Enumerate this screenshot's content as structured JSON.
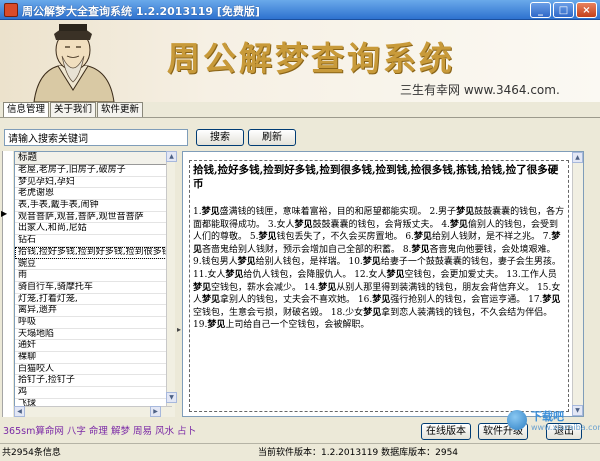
{
  "window": {
    "title": "周公解梦大全查询系统 1.2.2013119 [免费版]",
    "controls": [
      "_",
      "□",
      "×"
    ]
  },
  "banner": {
    "title": "周公解梦查询系统",
    "subtitle": "三生有幸网 www.3464.com."
  },
  "tabs": [
    "信息管理",
    "关于我们",
    "软件更新"
  ],
  "search": {
    "placeholder": "请输入搜索关键词",
    "search_label": "搜索",
    "refresh_label": "刷新"
  },
  "list": {
    "header": "标题",
    "items": [
      "老屋,老房子,旧房子,破房子",
      "梦见孕妇,孕妇",
      "老虎谢恩",
      "表,手表,戴手表,闹钟",
      "观音菩萨,观音,菩萨,观世音菩萨",
      "出家人,和尚,尼姑",
      "钻石",
      "拾钱,捡好多钱,捡到好多钱,捡到很多钱",
      "豌豆",
      "雨",
      "骑自行车,骑摩托车",
      "灯笼,打着灯笼,",
      "离异,遗弃",
      "呼吸",
      "天塌地陷",
      "通奸",
      "裸聊",
      "白猫咬人",
      "拾钉子,捡钉子",
      "鸡",
      "飞球"
    ],
    "selected_index": 7
  },
  "detail": {
    "title": "拾钱,捡好多钱,捡到好多钱,捡到很多钱,捡到钱,捡很多钱,拣钱,拾钱,捡了很多硬币",
    "body": [
      {
        "t": "1."
      },
      {
        "b": "梦见"
      },
      {
        "t": "盛满钱的钱匣，意味着富裕，目的和愿望都能实现。  2.男子"
      },
      {
        "b": "梦见"
      },
      {
        "t": "鼓鼓囊囊的钱包，各方面都能取得成功。  3.女人"
      },
      {
        "b": "梦见"
      },
      {
        "t": "鼓鼓囊囊的钱包，会背叛丈夫。  4."
      },
      {
        "b": "梦见"
      },
      {
        "t": "偷别人的钱包，会受到人们的尊敬。  5."
      },
      {
        "b": "梦见"
      },
      {
        "t": "钱包丢失了，不久会买房置地。  6."
      },
      {
        "b": "梦见"
      },
      {
        "t": "给别人钱财，是不祥之兆。  7."
      },
      {
        "b": "梦见"
      },
      {
        "t": "吝啬鬼给别人钱财，预示会增加自己全部的积蓄。  8."
      },
      {
        "b": "梦见"
      },
      {
        "t": "吝啬鬼向他要钱，会处境艰难。  9.钱包男人"
      },
      {
        "b": "梦见"
      },
      {
        "t": "给别人钱包，是祥瑞。  10."
      },
      {
        "b": "梦见"
      },
      {
        "t": "给妻子一个鼓鼓囊囊的钱包，妻子会生男孩。  11.女人"
      },
      {
        "b": "梦见"
      },
      {
        "t": "给仇人钱包，会降服仇人。  12.女人"
      },
      {
        "b": "梦见"
      },
      {
        "t": "空钱包，会更加爱丈夫。  13.工作人员"
      },
      {
        "b": "梦见"
      },
      {
        "t": "空钱包，薪水会减少。  14."
      },
      {
        "b": "梦见"
      },
      {
        "t": "从别人那里得到装满钱的钱包，朋友会背信弃义。  15.女人"
      },
      {
        "b": "梦见"
      },
      {
        "t": "拿别人的钱包，丈夫会不喜欢她。  16."
      },
      {
        "b": "梦见"
      },
      {
        "t": "强行抢别人的钱包，会官运亨通。  17."
      },
      {
        "b": "梦见"
      },
      {
        "t": "空钱包，生意会亏损，财破名毁。  18.少女"
      },
      {
        "b": "梦见"
      },
      {
        "t": "拿到恋人装满钱的钱包，不久会结为伴侣。  19."
      },
      {
        "b": "梦见"
      },
      {
        "t": "上司给自己一个空钱包，会被解职。"
      }
    ]
  },
  "links": [
    "365sm算命网",
    "八字",
    "命理",
    "解梦",
    "周易",
    "风水",
    "占卜"
  ],
  "buttons": {
    "online": "在线版本",
    "upgrade": "软件升级",
    "exit": "退出"
  },
  "status": {
    "left": "共2954条信息",
    "right": "当前软件版本：1.2.2013119 数据库版本：2954"
  },
  "watermark": {
    "name": "下载吧",
    "url": "www.xiazaiba.com"
  }
}
